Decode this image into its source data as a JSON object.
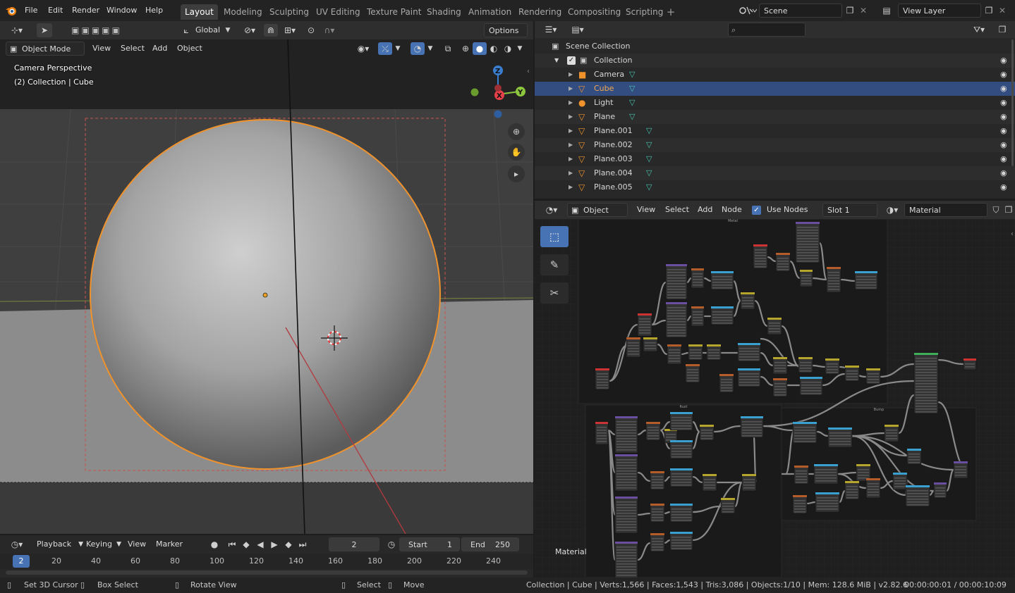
{
  "menu": {
    "items": [
      "File",
      "Edit",
      "Render",
      "Window",
      "Help"
    ],
    "workspaces": [
      "Layout",
      "Modeling",
      "Sculpting",
      "UV Editing",
      "Texture Paint",
      "Shading",
      "Animation",
      "Rendering",
      "Compositing",
      "Scripting"
    ],
    "active_workspace": "Layout",
    "scene": "Scene",
    "view_layer": "View Layer"
  },
  "viewport": {
    "transform_orientation": "Global",
    "options_label": "Options",
    "mode": "Object Mode",
    "menus": [
      "View",
      "Select",
      "Add",
      "Object"
    ],
    "info_line1": "Camera Perspective",
    "info_line2": "(2) Collection | Cube",
    "gizmo": {
      "x": "X",
      "y": "Y",
      "z": "Z"
    }
  },
  "outliner": {
    "root": "Scene Collection",
    "collection": "Collection",
    "objects": [
      "Camera",
      "Cube",
      "Light",
      "Plane",
      "Plane.001",
      "Plane.002",
      "Plane.003",
      "Plane.004",
      "Plane.005"
    ],
    "selected": "Cube"
  },
  "node_editor": {
    "object_type": "Object",
    "menus": [
      "View",
      "Select",
      "Add",
      "Node"
    ],
    "use_nodes_label": "Use Nodes",
    "use_nodes": true,
    "slot": "Slot 1",
    "material": "Material",
    "frame_labels": [
      "Metal",
      "Rust",
      "Bump"
    ],
    "tree_label": "Material"
  },
  "timeline": {
    "menus": [
      "Playback",
      "Keying",
      "View",
      "Marker"
    ],
    "current_frame": "2",
    "start_label": "Start",
    "start": "1",
    "end_label": "End",
    "end": "250",
    "ruler": [
      "20",
      "40",
      "60",
      "80",
      "100",
      "120",
      "140",
      "160",
      "180",
      "200",
      "220",
      "240"
    ],
    "playhead": "2"
  },
  "statusbar": {
    "set_cursor": "Set 3D Cursor",
    "box_select": "Box Select",
    "rotate_view": "Rotate View",
    "select": "Select",
    "move": "Move",
    "stats": "Collection | Cube | Verts:1,566 | Faces:1,543 | Tris:3,086 | Objects:1/10 | Mem: 128.6 MiB | v2.82.6",
    "time": "00:00:00:01 / 00:00:10:09"
  },
  "colors": {
    "selection_orange": "#f0922c",
    "outliner_highlight": "#334d80",
    "header_tab_active": "#3d3d3d",
    "accent_blue": "#4772b3",
    "x_axis": "#e5404a",
    "y_axis": "#8cc63f",
    "z_axis": "#3a7ecf",
    "mesh_icon": "#47c5b0"
  }
}
